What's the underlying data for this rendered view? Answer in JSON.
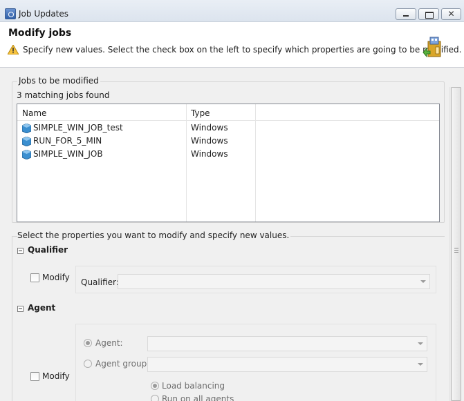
{
  "window": {
    "title": "Job Updates",
    "close_glyph": "✕"
  },
  "header": {
    "title": "Modify jobs",
    "message": "Specify new values. Select the check box on the left to specify which properties are going to be modified.",
    "warning_icon": "warning-icon",
    "wizard_icon": "wizard-banner-icon"
  },
  "jobs_group": {
    "label": "Jobs to be modified",
    "count_text": "3 matching jobs found",
    "columns": [
      "Name",
      "Type"
    ],
    "rows": [
      {
        "name": "SIMPLE_WIN_JOB_test",
        "type": "Windows"
      },
      {
        "name": "RUN_FOR_5_MIN",
        "type": "Windows"
      },
      {
        "name": "SIMPLE_WIN_JOB",
        "type": "Windows"
      }
    ]
  },
  "properties": {
    "label": "Select the properties you want to modify and specify new values.",
    "qualifier": {
      "section_title": "Qualifier",
      "modify_label": "Modify",
      "modify_checked": false,
      "field_label": "Qualifier:",
      "field_value": ""
    },
    "agent": {
      "section_title": "Agent",
      "modify_label": "Modify",
      "modify_checked": false,
      "agent_label": "Agent:",
      "agent_value": "",
      "agent_group_label": "Agent group:",
      "agent_group_value": "",
      "load_balancing_label": "Load balancing",
      "run_all_label": "Run on all agents"
    }
  },
  "colors": {
    "panel_bg": "#f0f0f0",
    "header_bg": "#ffffff",
    "job_icon": "#2f86c7"
  }
}
